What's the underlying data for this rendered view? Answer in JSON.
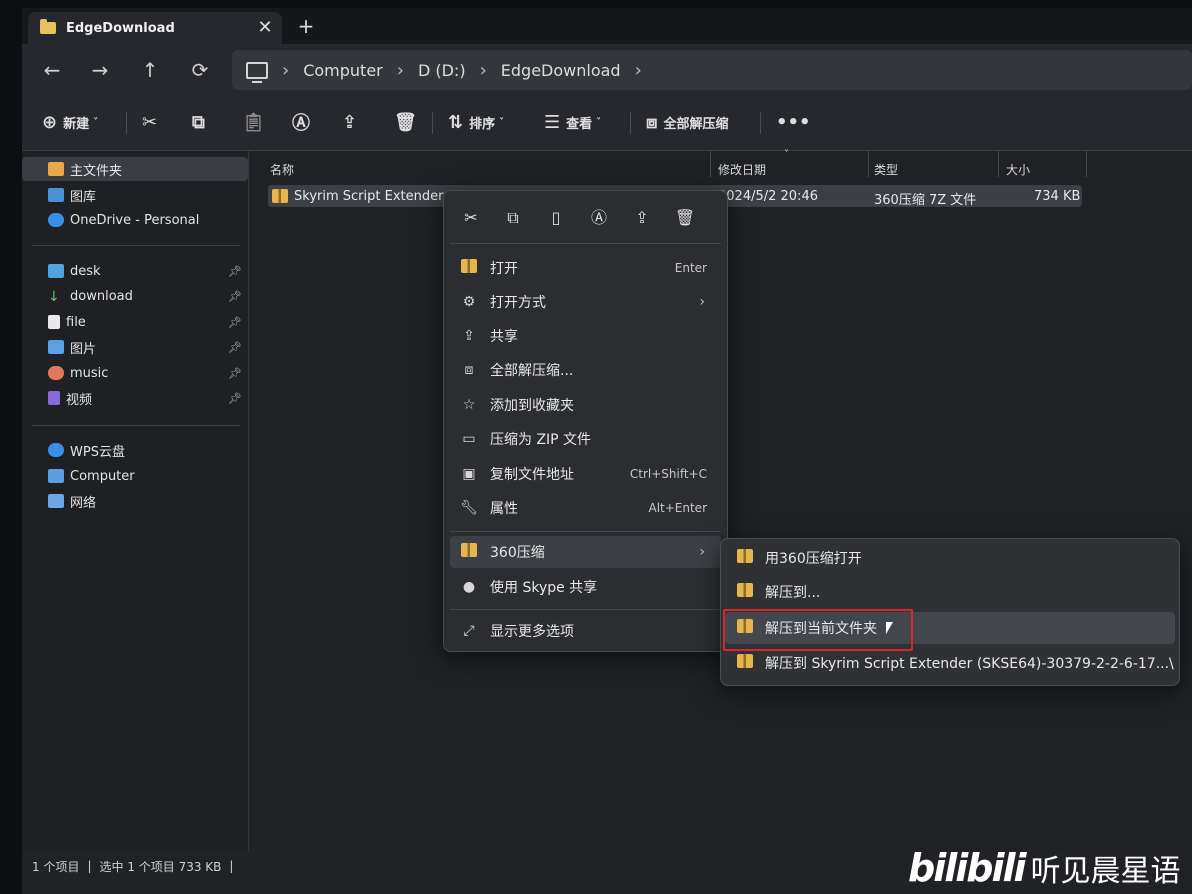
{
  "tab": {
    "title": "EdgeDownload",
    "close": "✕",
    "new": "+"
  },
  "nav": {
    "back": "←",
    "forward": "→",
    "up": "↑",
    "refresh": "⟳"
  },
  "address": {
    "crumbs": [
      "Computer",
      "D (D:)",
      "EdgeDownload"
    ],
    "sep": "›"
  },
  "toolbar": {
    "new_label": "新建",
    "sort_label": "排序",
    "view_label": "查看",
    "extract_all_label": "全部解压缩",
    "more": "•••"
  },
  "sidebar": {
    "home": "主文件夹",
    "gallery": "图库",
    "onedrive": "OneDrive - Personal",
    "pinned": [
      "desk",
      "download",
      "file",
      "图片",
      "music",
      "视频"
    ],
    "wps": "WPS云盘",
    "computer": "Computer",
    "network": "网络"
  },
  "columns": {
    "name": "名称",
    "modified": "修改日期",
    "type": "类型",
    "size": "大小"
  },
  "file": {
    "name": "Skyrim Script Extender (SKSE64)-30379-2-2-6-1705...",
    "modified": "2024/5/2 20:46",
    "type": "360压缩 7Z 文件",
    "size": "734 KB"
  },
  "status": {
    "count": "1 个项目",
    "selected": "选中 1 个项目 733 KB",
    "bar": "|"
  },
  "context_menu": {
    "open": "打开",
    "open_sc": "Enter",
    "open_with": "打开方式",
    "share": "共享",
    "extract_all": "全部解压缩...",
    "favorite": "添加到收藏夹",
    "zip": "压缩为 ZIP 文件",
    "copy_path": "复制文件地址",
    "copy_path_sc": "Ctrl+Shift+C",
    "properties": "属性",
    "properties_sc": "Alt+Enter",
    "zip360": "360压缩",
    "skype": "使用 Skype 共享",
    "more_options": "显示更多选项",
    "arrow": "›"
  },
  "submenu": {
    "open360": "用360压缩打开",
    "extract_to": "解压到...",
    "extract_here": "解压到当前文件夹",
    "extract_named": "解压到 Skyrim Script Extender (SKSE64)-30379-2-2-6-17...\\"
  },
  "watermark": {
    "logo": "bilibili",
    "text": "听见晨星语"
  }
}
